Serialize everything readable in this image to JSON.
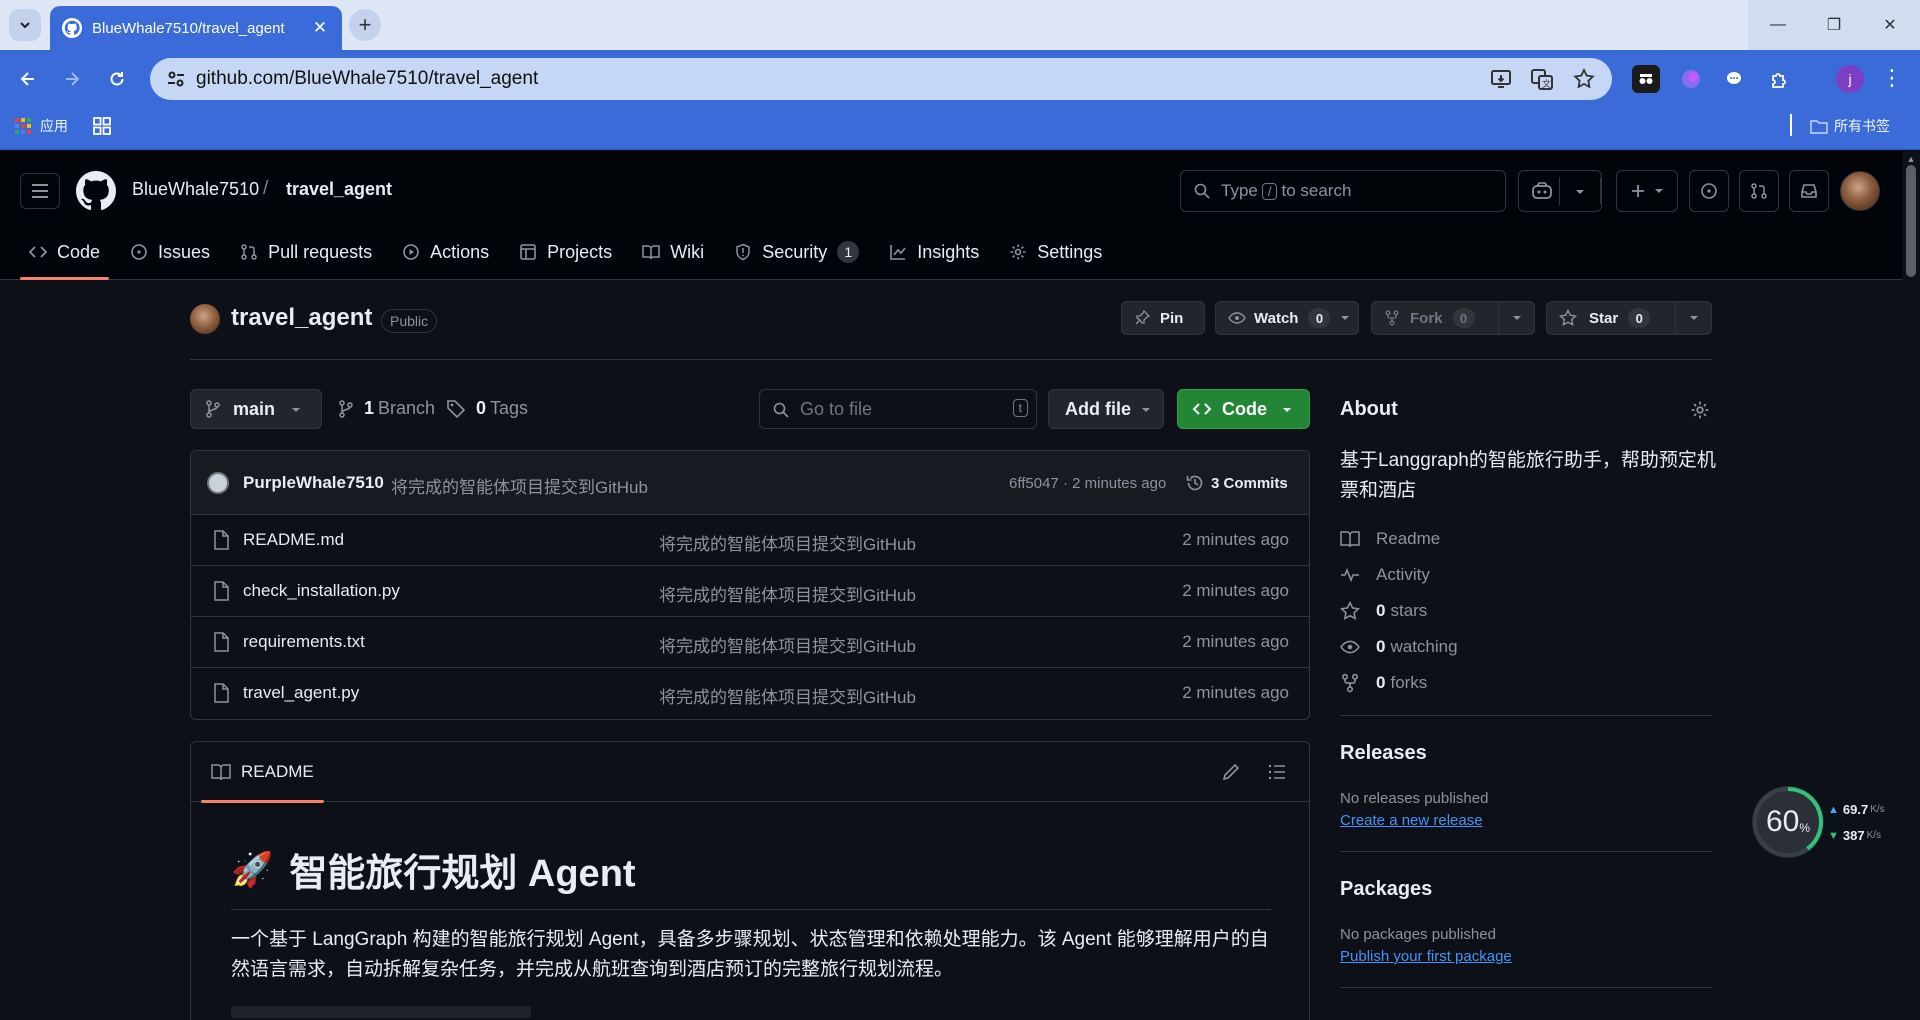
{
  "browser": {
    "tab_title": "BlueWhale7510/travel_agent",
    "url": "github.com/BlueWhale7510/travel_agent",
    "bookmark_apps": "应用",
    "bookmark_all": "所有书签",
    "profile_initial": "j"
  },
  "header": {
    "owner": "BlueWhale7510",
    "slash": "/",
    "repo": "travel_agent",
    "search_type": "Type",
    "search_key": "/",
    "search_suffix": "to search"
  },
  "nav": {
    "code": "Code",
    "issues": "Issues",
    "pulls": "Pull requests",
    "actions": "Actions",
    "projects": "Projects",
    "wiki": "Wiki",
    "security": "Security",
    "security_count": "1",
    "insights": "Insights",
    "settings": "Settings"
  },
  "repo": {
    "name": "travel_agent",
    "visibility": "Public",
    "pin": "Pin",
    "watch": "Watch",
    "watch_count": "0",
    "fork": "Fork",
    "fork_count": "0",
    "star": "Star",
    "star_count": "0"
  },
  "toolbar": {
    "branch": "main",
    "branch_count": "1",
    "branch_label": "Branch",
    "tag_count": "0",
    "tag_label": "Tags",
    "goto_placeholder": "Go to file",
    "goto_key": "t",
    "add_file": "Add file",
    "code": "Code"
  },
  "commit": {
    "author": "PurpleWhale7510",
    "message": "将完成的智能体项目提交到GitHub",
    "hash_time": "6ff5047 · 2 minutes ago",
    "commits": "3 Commits"
  },
  "files": [
    {
      "name": "README.md",
      "message": "将完成的智能体项目提交到GitHub",
      "date": "2 minutes ago"
    },
    {
      "name": "check_installation.py",
      "message": "将完成的智能体项目提交到GitHub",
      "date": "2 minutes ago"
    },
    {
      "name": "requirements.txt",
      "message": "将完成的智能体项目提交到GitHub",
      "date": "2 minutes ago"
    },
    {
      "name": "travel_agent.py",
      "message": "将完成的智能体项目提交到GitHub",
      "date": "2 minutes ago"
    }
  ],
  "readme": {
    "tab": "README",
    "emoji": "🚀",
    "heading": "智能旅行规划 Agent",
    "paragraph": "一个基于 LangGraph 构建的智能旅行规划 Agent，具备多步骤规划、状态管理和依赖处理能力。该 Agent 能够理解用户的自然语言需求，自动拆解复杂任务，并完成从航班查询到酒店预订的完整旅行规划流程。"
  },
  "about": {
    "title": "About",
    "description": "基于Langgraph的智能旅行助手，帮助预定机票和酒店",
    "readme": "Readme",
    "activity": "Activity",
    "stars_n": "0",
    "stars": "stars",
    "watching_n": "0",
    "watching": "watching",
    "forks_n": "0",
    "forks": "forks"
  },
  "releases": {
    "title": "Releases",
    "none": "No releases published",
    "link": "Create a new release"
  },
  "packages": {
    "title": "Packages",
    "none": "No packages published",
    "link": "Publish your first package"
  },
  "speed_widget": {
    "percent": "60",
    "percent_unit": "%",
    "up": "69.7",
    "down": "387",
    "unit": "K/s"
  }
}
